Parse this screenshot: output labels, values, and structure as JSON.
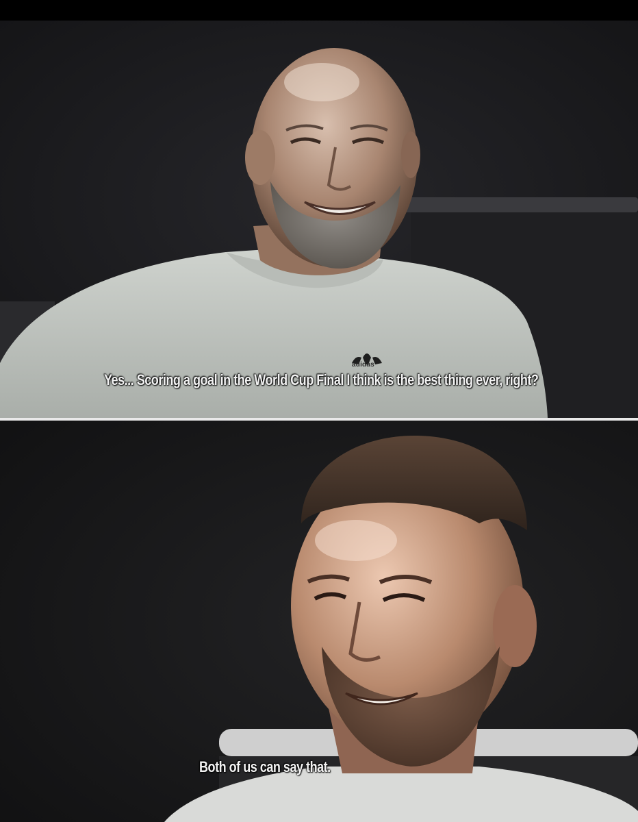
{
  "panels": [
    {
      "subtitle": "Yes... Scoring a goal in the World Cup Final I think is the best thing ever, right?",
      "shirt_logo_text": "adidas"
    },
    {
      "subtitle": "Both of us can say that."
    }
  ],
  "colors": {
    "background": "#000000",
    "subtitle_text": "#f2f2f2",
    "divider": "#e9e9e9"
  }
}
